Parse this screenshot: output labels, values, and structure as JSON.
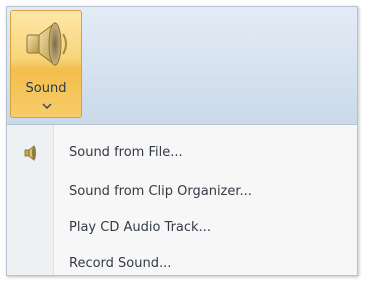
{
  "ribbon": {
    "sound_button": {
      "label": "Sound",
      "icon": "speaker-icon"
    }
  },
  "menu": {
    "items": [
      {
        "label": "Sound from File...",
        "icon": "sound-file-icon"
      },
      {
        "label": "Sound from Clip Organizer..."
      },
      {
        "label": "Play CD Audio Track..."
      },
      {
        "label": "Record Sound..."
      }
    ]
  },
  "colors": {
    "button_highlight": "#f9d57a",
    "ribbon_background": "#d7e3f0",
    "menu_background": "#f7f7f7",
    "text": "#333b46"
  }
}
